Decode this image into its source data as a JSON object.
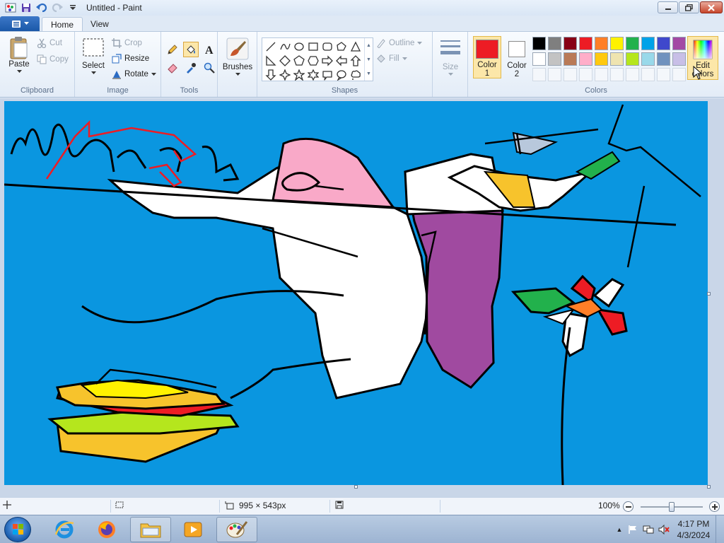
{
  "window": {
    "title": "Untitled - Paint"
  },
  "tabs": {
    "home": "Home",
    "view": "View"
  },
  "clipboard": {
    "paste": "Paste",
    "cut": "Cut",
    "copy": "Copy",
    "group": "Clipboard"
  },
  "image": {
    "select": "Select",
    "crop": "Crop",
    "resize": "Resize",
    "rotate": "Rotate",
    "group": "Image"
  },
  "tools": {
    "group": "Tools",
    "items": [
      "pencil-icon",
      "fill-icon",
      "text-icon",
      "eraser-icon",
      "color-picker-icon",
      "magnifier-icon"
    ],
    "selected": "fill-icon"
  },
  "brushes": {
    "label": "Brushes"
  },
  "shapes": {
    "group": "Shapes",
    "outline": "Outline",
    "fill": "Fill",
    "items": [
      "line",
      "curve",
      "oval",
      "rectangle",
      "rounded-rectangle",
      "polygon",
      "triangle",
      "right-triangle",
      "diamond",
      "pentagon",
      "hexagon",
      "right-arrow",
      "left-arrow",
      "up-arrow",
      "down-arrow",
      "four-point-star",
      "five-point-star",
      "six-point-star",
      "rounded-callout",
      "oval-callout",
      "cloud-callout"
    ]
  },
  "size": {
    "label": "Size"
  },
  "colors": {
    "group": "Colors",
    "color1_label_a": "Color",
    "color1_label_b": "1",
    "color2_label_a": "Color",
    "color2_label_b": "2",
    "color1": "#ed1c24",
    "color2": "#ffffff",
    "edit_label_a": "Edit",
    "edit_label_b": "colors",
    "palette_row1": [
      "#000000",
      "#7f7f7f",
      "#880015",
      "#ed1c24",
      "#ff7f27",
      "#fff200",
      "#22b14c",
      "#00a2e8",
      "#3f48cc",
      "#a349a4"
    ],
    "palette_row2": [
      "#ffffff",
      "#c3c3c3",
      "#b97a57",
      "#ffaec9",
      "#ffc90e",
      "#efe4b0",
      "#b5e61d",
      "#99d9ea",
      "#7092be",
      "#c8bfe7"
    ]
  },
  "status": {
    "canvas_size": "995 × 543px",
    "zoom": "100%",
    "zoom_fraction": 0.5
  },
  "taskbar": {
    "apps": [
      "internet-explorer-icon",
      "firefox-icon",
      "file-explorer-icon",
      "media-player-icon",
      "paint-icon"
    ],
    "time": "4:17 PM",
    "date": "4/3/2024"
  }
}
